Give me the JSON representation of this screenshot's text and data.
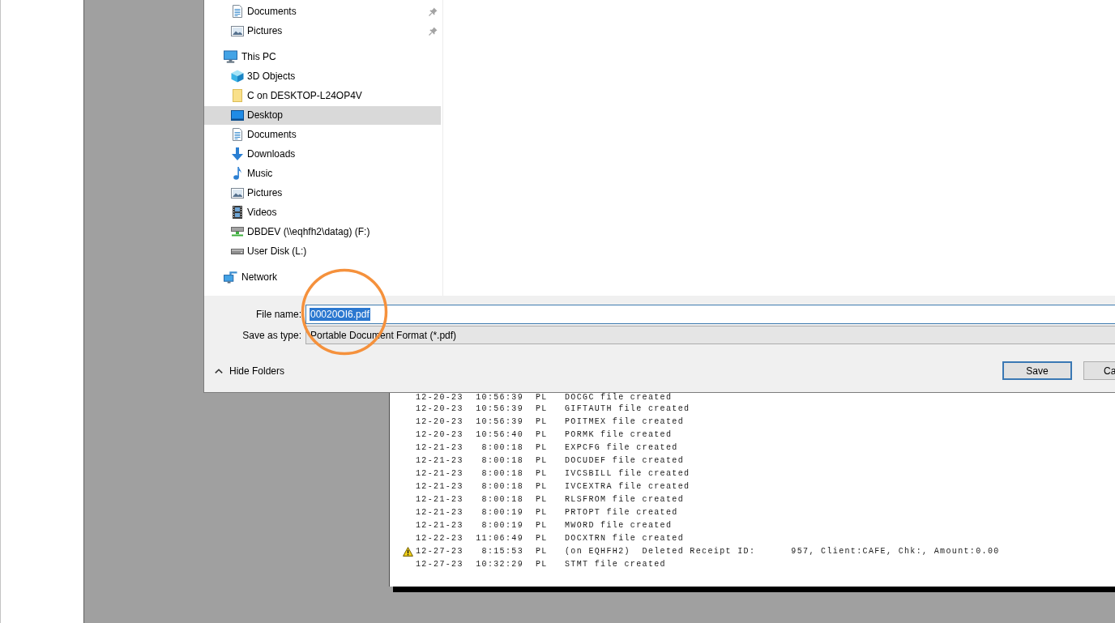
{
  "dialog": {
    "navigation": {
      "pinned_items": [
        {
          "label": "Documents",
          "kind": "documents",
          "pinned": true,
          "selected": false
        },
        {
          "label": "Pictures",
          "kind": "pictures",
          "pinned": true,
          "selected": false
        }
      ],
      "tree": [
        {
          "label": "This PC",
          "kind": "computer",
          "selected": false,
          "children": [
            {
              "label": "3D Objects",
              "kind": "cube",
              "selected": false
            },
            {
              "label": "C on DESKTOP-L24OP4V",
              "kind": "folder",
              "selected": false
            },
            {
              "label": "Desktop",
              "kind": "desktop",
              "selected": true
            },
            {
              "label": "Documents",
              "kind": "documents",
              "selected": false
            },
            {
              "label": "Downloads",
              "kind": "downloads",
              "selected": false
            },
            {
              "label": "Music",
              "kind": "music",
              "selected": false
            },
            {
              "label": "Pictures",
              "kind": "pictures",
              "selected": false
            },
            {
              "label": "Videos",
              "kind": "videos",
              "selected": false
            },
            {
              "label": "DBDEV (\\\\eqhfh2\\datag) (F:)",
              "kind": "network-drive",
              "selected": false
            },
            {
              "label": "User Disk (L:)",
              "kind": "drive",
              "selected": false
            }
          ]
        },
        {
          "label": "Network",
          "kind": "network",
          "selected": false
        }
      ]
    },
    "file_name": {
      "label": "File name:",
      "value": "00020OI6.pdf",
      "value_selected": true
    },
    "save_as_type": {
      "label": "Save as type:",
      "value": "Portable Document Format (*.pdf)"
    },
    "hide_folders": {
      "label": "Hide Folders"
    },
    "buttons": [
      {
        "label": "Save",
        "default": true
      },
      {
        "label": "Ca",
        "default": false
      }
    ]
  },
  "document": {
    "log_lines": [
      {
        "date": "12-20-23",
        "time": "10:56:39",
        "user": "PL",
        "message": "DOCGC file created",
        "warning": false
      },
      {
        "date": "12-20-23",
        "time": "10:56:39",
        "user": "PL",
        "message": "GIFTAUTH file created",
        "warning": false
      },
      {
        "date": "12-20-23",
        "time": "10:56:39",
        "user": "PL",
        "message": "POITMEX file created",
        "warning": false
      },
      {
        "date": "12-20-23",
        "time": "10:56:40",
        "user": "PL",
        "message": "PORMK file created",
        "warning": false
      },
      {
        "date": "12-21-23",
        "time": "8:00:18",
        "user": "PL",
        "message": "EXPCFG file created",
        "warning": false
      },
      {
        "date": "12-21-23",
        "time": "8:00:18",
        "user": "PL",
        "message": "DOCUDEF file created",
        "warning": false
      },
      {
        "date": "12-21-23",
        "time": "8:00:18",
        "user": "PL",
        "message": "IVCSBILL file created",
        "warning": false
      },
      {
        "date": "12-21-23",
        "time": "8:00:18",
        "user": "PL",
        "message": "IVCEXTRA file created",
        "warning": false
      },
      {
        "date": "12-21-23",
        "time": "8:00:18",
        "user": "PL",
        "message": "RLSFROM file created",
        "warning": false
      },
      {
        "date": "12-21-23",
        "time": "8:00:19",
        "user": "PL",
        "message": "PRTOPT file created",
        "warning": false
      },
      {
        "date": "12-21-23",
        "time": "8:00:19",
        "user": "PL",
        "message": "MWORD file created",
        "warning": false
      },
      {
        "date": "12-22-23",
        "time": "11:06:49",
        "user": "PL",
        "message": "DOCXTRN file created",
        "warning": false
      },
      {
        "date": "12-27-23",
        "time": "8:15:53",
        "user": "PL",
        "message": "(on EQHFH2)  Deleted Receipt ID:      957, Client:CAFE, Chk:, Amount:0.00",
        "warning": true
      },
      {
        "date": "12-27-23",
        "time": "10:32:29",
        "user": "PL",
        "message": "STMT file created",
        "warning": false
      }
    ]
  }
}
